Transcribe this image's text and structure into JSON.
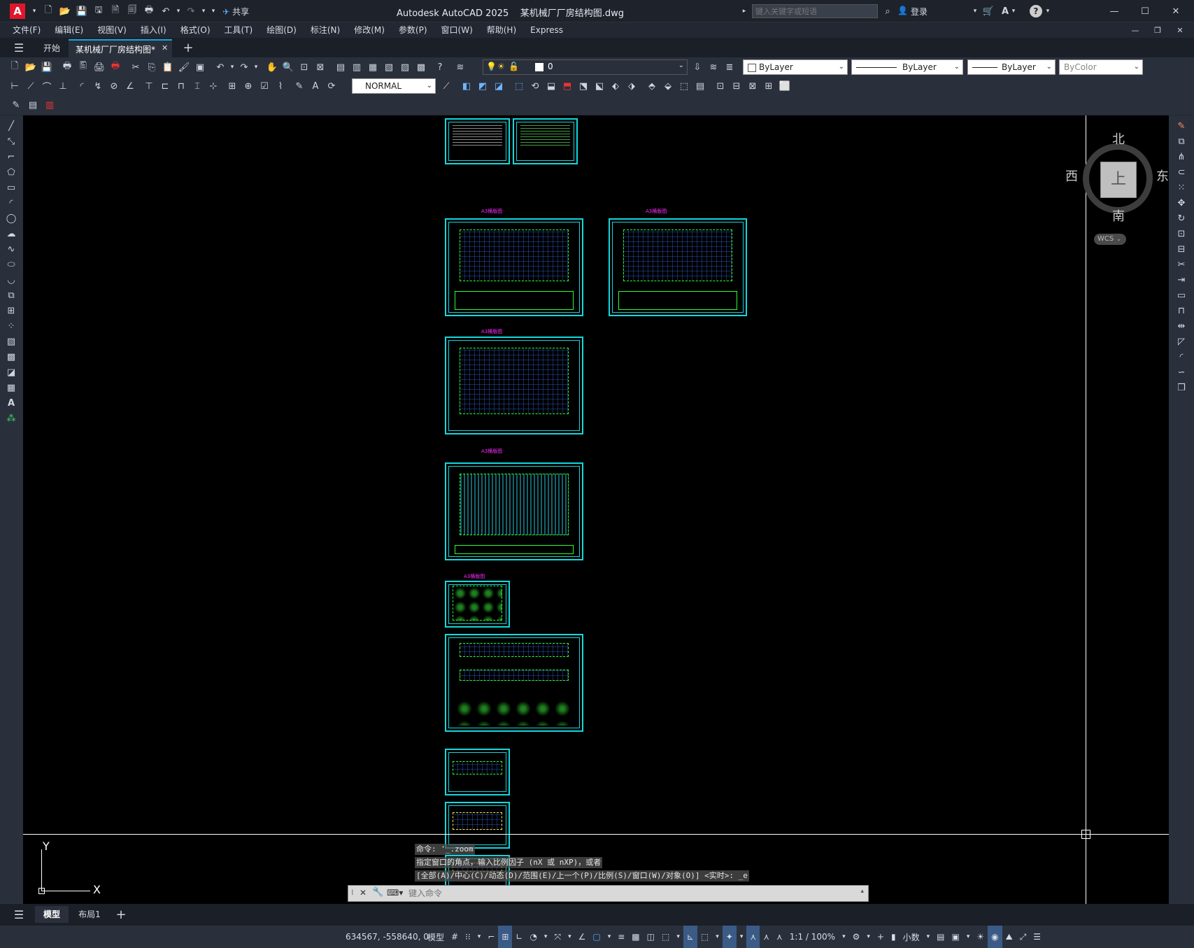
{
  "app": {
    "title": "Autodesk AutoCAD 2025    某机械厂厂房结构图.dwg",
    "search_placeholder": "键入关键字或短语",
    "login": "登录",
    "share": "共享",
    "logo": "A"
  },
  "menu": [
    "文件(F)",
    "编辑(E)",
    "视图(V)",
    "插入(I)",
    "格式(O)",
    "工具(T)",
    "绘图(D)",
    "标注(N)",
    "修改(M)",
    "参数(P)",
    "窗口(W)",
    "帮助(H)",
    "Express"
  ],
  "tabs": {
    "start": "开始",
    "doc": "某机械厂厂房结构图*"
  },
  "layer": {
    "current": "0"
  },
  "props": {
    "color": "ByLayer",
    "linetype": "ByLayer",
    "lineweight": "ByLayer",
    "plotstyle": "ByColor"
  },
  "dimstyle": "NORMAL",
  "viewcube": {
    "north": "北",
    "south": "南",
    "east": "东",
    "west": "西",
    "face": "上",
    "wcs": "WCS"
  },
  "ucs": {
    "x": "X",
    "y": "Y"
  },
  "command": {
    "history": [
      "命令: '_.zoom",
      "指定窗口的角点，输入比例因子 (nX 或 nXP)，或者",
      "[全部(A)/中心(C)/动态(D)/范围(E)/上一个(P)/比例(S)/窗口(W)/对象(O)] <实时>: _e"
    ],
    "placeholder": "键入命令"
  },
  "layouts": {
    "model": "模型",
    "layout1": "布局1"
  },
  "status": {
    "coords": "634567, -558640, 0",
    "model": "模型",
    "scale": "1:1 / 100%",
    "units": "小数"
  },
  "sheet_labels": [
    "A3横版图",
    "A3横版图",
    "A3横版图",
    "A3横版图",
    "A3横版图"
  ],
  "colors": {
    "accent": "#14d7dc",
    "canvas": "#000000",
    "chrome": "#2a303b",
    "logo": "#e0162b"
  }
}
